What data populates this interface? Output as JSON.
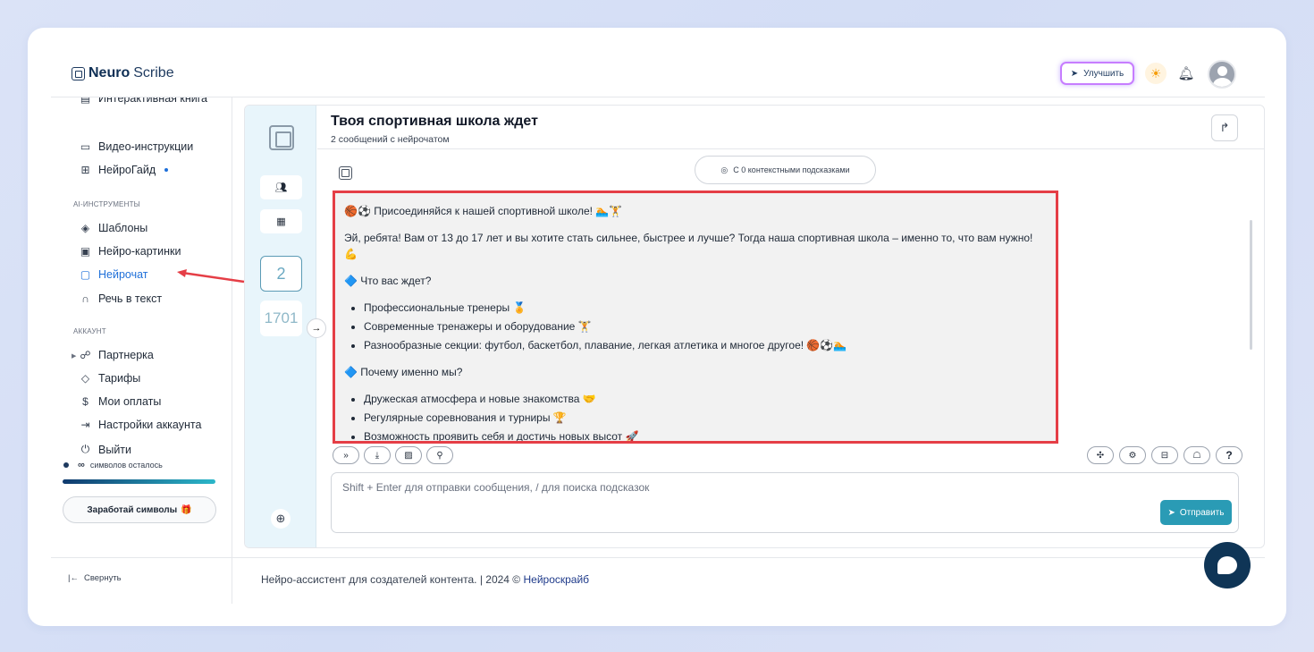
{
  "brand": {
    "bold": "Neuro",
    "rest": "Scribe"
  },
  "header": {
    "upgrade_label": "Улучшить"
  },
  "sidebar": {
    "items_top": [
      {
        "label": "Интерактивная книга",
        "icon": "book-icon"
      },
      {
        "label": "Видео-инструкции",
        "icon": "video-icon"
      },
      {
        "label": "НейроГайд",
        "icon": "guide-icon"
      }
    ],
    "section_ai": "AI-ИНСТРУМЕНТЫ",
    "items_ai": [
      {
        "label": "Шаблоны",
        "icon": "layers-icon"
      },
      {
        "label": "Нейро-картинки",
        "icon": "image-icon"
      },
      {
        "label": "Нейрочат",
        "icon": "chat-icon"
      },
      {
        "label": "Речь в текст",
        "icon": "headphones-icon"
      }
    ],
    "section_account": "АККАУНТ",
    "items_account": [
      {
        "label": "Партнерка",
        "icon": "users-icon"
      },
      {
        "label": "Тарифы",
        "icon": "tag-icon"
      },
      {
        "label": "Мои оплаты",
        "icon": "dollar-icon"
      },
      {
        "label": "Настройки аккаунта",
        "icon": "settings-icon"
      },
      {
        "label": "Выйти",
        "icon": "power-icon"
      }
    ],
    "symbols_infinity": "∞",
    "symbols_text": "символов осталось",
    "earn_label": "Заработай символы",
    "collapse_label": "Свернуть"
  },
  "rail": {
    "messages_count": "2",
    "chars_count": "1701"
  },
  "chat": {
    "title": "Твоя спортивная школа ждет",
    "subtitle": "2 сообщений с нейрочатом",
    "context_label": "С 0 контекстными подсказками",
    "message": {
      "heading": "🏀⚽ Присоединяйся к нашей спортивной школе! 🏊🏋",
      "intro": "Эй, ребята! Вам от 13 до 17 лет и вы хотите стать сильнее, быстрее и лучше? Тогда наша спортивная школа – именно то, что вам нужно! 💪",
      "section1": "🔷 Что вас ждет?",
      "list1": [
        "Профессиональные тренеры 🏅",
        "Современные тренажеры и оборудование 🏋",
        "Разнообразные секции: футбол, баскетбол, плавание, легкая атлетика и многое другое! 🏀⚽🏊"
      ],
      "section2": "🔷 Почему именно мы?",
      "list2": [
        "Дружеская атмосфера и новые знакомства 🤝",
        "Регулярные соревнования и турниры 🏆",
        "Возможность проявить себя и достичь новых высот 🚀"
      ]
    },
    "input_placeholder": "Shift + Enter для отправки сообщения, / для поиска подсказок",
    "send_label": "Отправить"
  },
  "footer": {
    "text": "Нейро-ассистент для создателей контента.  | 2024 © ",
    "link": "Нейроскрайб"
  }
}
